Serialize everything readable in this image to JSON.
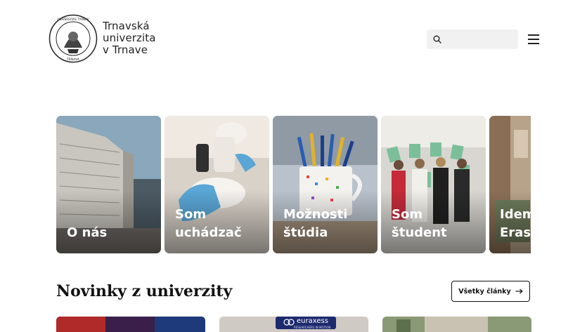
{
  "header": {
    "brand_lines": [
      "Trnavská",
      "univerzita",
      "v Trnave"
    ],
    "seal_text_top": "UNIVERSITAS TYRNAVIENSIS",
    "seal_text_bottom": "TRNAVA",
    "search_placeholder": ""
  },
  "cards": [
    {
      "line1": "O nás",
      "line2": ""
    },
    {
      "line1": "Som",
      "line2": "uchádzač"
    },
    {
      "line1": "Možnosti",
      "line2": "štúdia"
    },
    {
      "line1": "Som",
      "line2": "študent"
    },
    {
      "line1": "Idem",
      "line2": "Eras"
    }
  ],
  "news": {
    "title": "Novinky z univerzity",
    "all_button": "Všetky články",
    "thumb2_text": "euraxess",
    "thumb2_subtext": "RESEARCHERS IN MOTION"
  }
}
